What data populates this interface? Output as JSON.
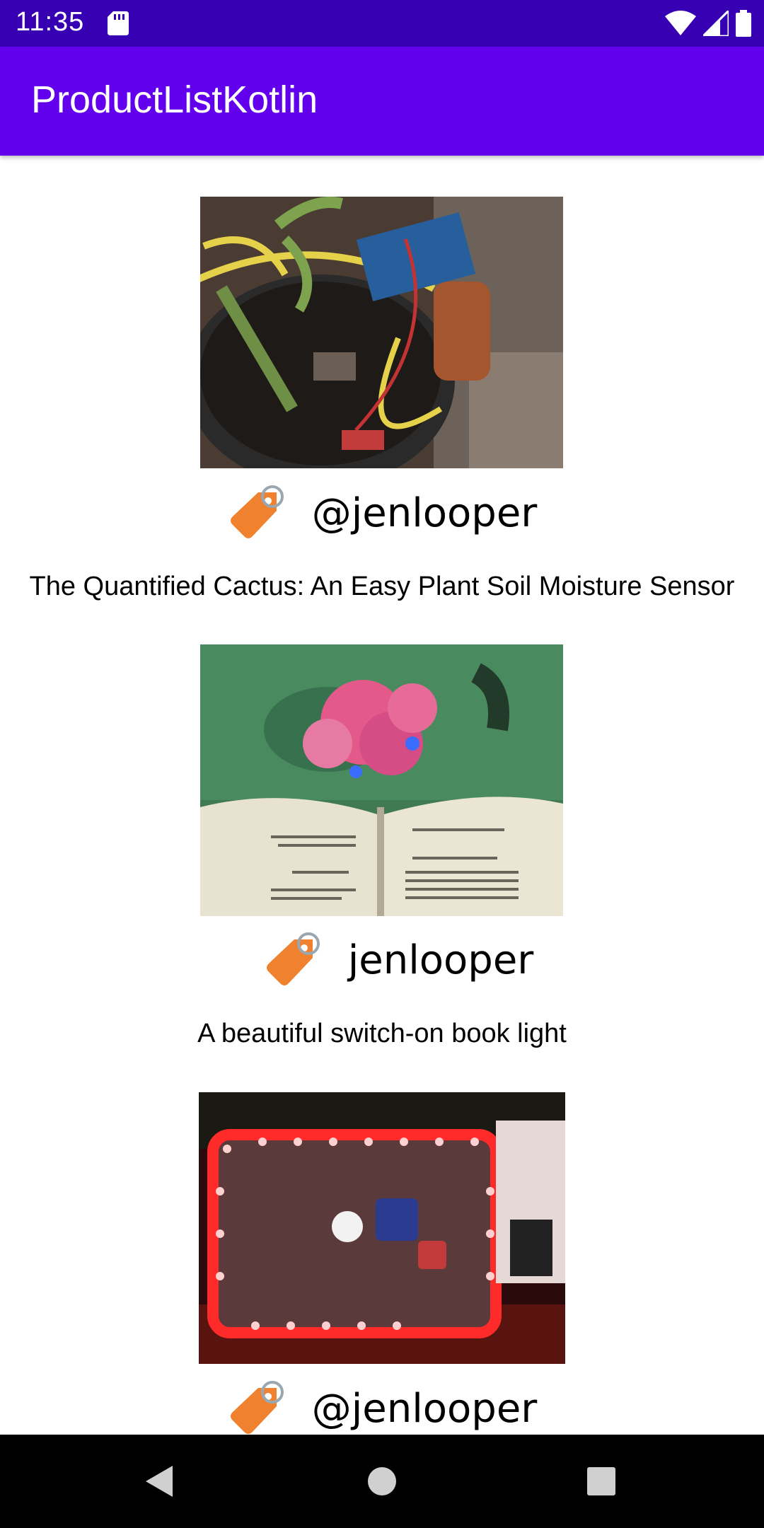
{
  "status_bar": {
    "time": "11:35",
    "icons": [
      "sd-card-icon",
      "wifi-icon",
      "cellular-signal-icon",
      "battery-icon"
    ]
  },
  "app_bar": {
    "title": "ProductListKotlin"
  },
  "products": [
    {
      "owner": "@jenlooper",
      "description": "The Quantified Cactus: An Easy Plant Soil Moisture Sensor",
      "image": "plant-soil-sensor-photo"
    },
    {
      "owner": "jenlooper",
      "description": "A beautiful switch-on book light",
      "image": "book-light-photo"
    },
    {
      "owner": "@jenlooper",
      "description": "",
      "image": "led-laptop-frame-photo"
    }
  ],
  "nav_bar": {
    "buttons": [
      "back-icon",
      "home-icon",
      "recents-icon"
    ]
  },
  "colors": {
    "status_bar": "#3700b3",
    "app_bar": "#6200ee",
    "tag_orange": "#f08030"
  }
}
